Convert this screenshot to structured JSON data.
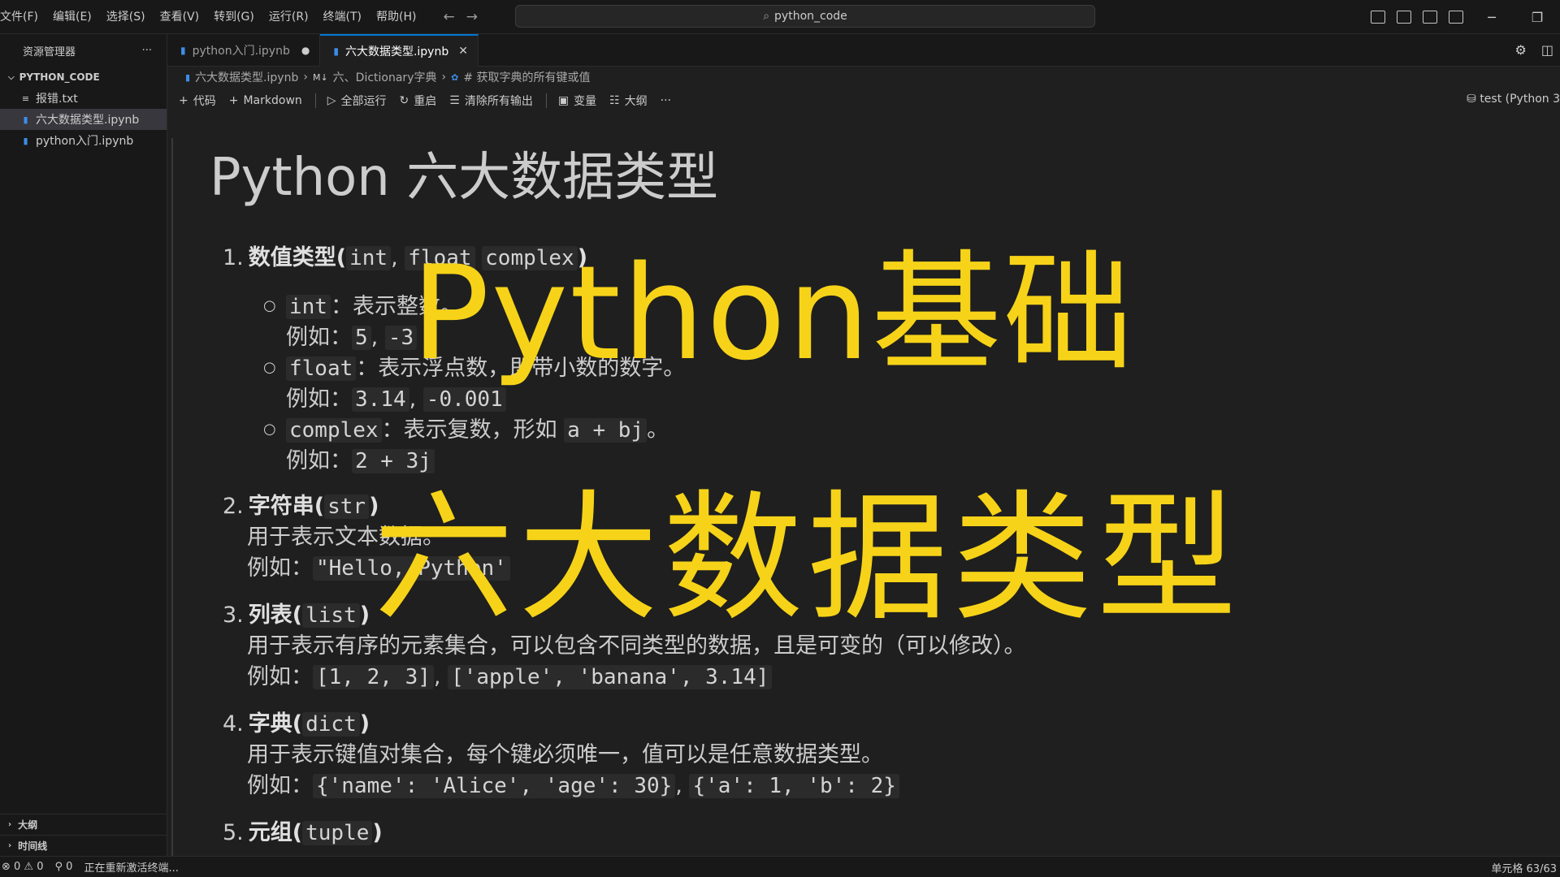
{
  "menu": [
    "文件(F)",
    "编辑(E)",
    "选择(S)",
    "查看(V)",
    "转到(G)",
    "运行(R)",
    "终端(T)",
    "帮助(H)"
  ],
  "search": {
    "text": "python_code"
  },
  "sidebar": {
    "title": "资源管理器",
    "more": "···",
    "folder": "PYTHON_CODE",
    "files": [
      {
        "name": "报错.txt",
        "icon": "text-file-icon"
      },
      {
        "name": "六大数据类型.ipynb",
        "icon": "notebook-icon",
        "active": true
      },
      {
        "name": "python入门.ipynb",
        "icon": "notebook-icon"
      }
    ],
    "outline": "大纲",
    "timeline": "时间线"
  },
  "tabs": [
    {
      "label": "python入门.ipynb",
      "modified": "●"
    },
    {
      "label": "六大数据类型.ipynb",
      "close": "✕"
    }
  ],
  "breadcrumb": {
    "file": "六大数据类型.ipynb",
    "section": "六、Dictionary字典",
    "cell": "# 获取字典的所有键或值"
  },
  "toolbar": {
    "code": "代码",
    "markdown": "Markdown",
    "run_all": "全部运行",
    "restart": "重启",
    "clear": "清除所有输出",
    "variables": "变量",
    "outline": "大纲",
    "more": "···",
    "kernel": "test (Python 3"
  },
  "notebook": {
    "title": "Python 六大数据类型",
    "item1": {
      "num": "1.",
      "label": "数值类型",
      "paren_open": "(",
      "c1": "int",
      "comma": ",",
      "c2": "float",
      "c3": "complex",
      "paren_close": ")"
    },
    "item1_int": {
      "code": "int",
      "desc": "：表示整数。"
    },
    "item1_int_ex": {
      "label": "例如：",
      "c1": "5",
      "c2": "-3"
    },
    "item1_float": {
      "code": "float",
      "desc": "：表示浮点数，即带小数的数字。"
    },
    "item1_float_ex": {
      "label": "例如：",
      "c1": "3.14",
      "c2": "-0.001"
    },
    "item1_complex": {
      "code": "complex",
      "desc": "：表示复数，形如",
      "c1": "a + bj",
      "end": "。"
    },
    "item1_complex_ex": {
      "label": "例如：",
      "c1": "2 + 3j"
    },
    "item2": {
      "num": "2.",
      "label": "字符串",
      "code": "str"
    },
    "item2_desc": "用于表示文本数据。",
    "item2_ex": {
      "label": "例如：",
      "c1": "\"Hello, Python'"
    },
    "item3": {
      "num": "3.",
      "label": "列表",
      "code": "list"
    },
    "item3_desc": "用于表示有序的元素集合，可以包含不同类型的数据，且是可变的（可以修改）。",
    "item3_ex": {
      "label": "例如：",
      "c1": "[1, 2, 3]",
      "c2": "['apple', 'banana', 3.14]"
    },
    "item4": {
      "num": "4.",
      "label": "字典",
      "code": "dict"
    },
    "item4_desc": "用于表示键值对集合，每个键必须唯一，值可以是任意数据类型。",
    "item4_ex": {
      "label": "例如：",
      "c1": "{'name': 'Alice', 'age': 30}",
      "c2": "{'a': 1, 'b': 2}"
    },
    "item5": {
      "num": "5.",
      "label": "元组",
      "code": "tuple"
    }
  },
  "overlay": {
    "line1": "Python基础",
    "line2": "六大数据类型",
    "color": "#f6d318"
  },
  "status": {
    "errors": "⊗ 0 ⚠ 0",
    "ports": "⚲ 0",
    "message": "正在重新激活终端...",
    "right": "单元格 63/63"
  }
}
